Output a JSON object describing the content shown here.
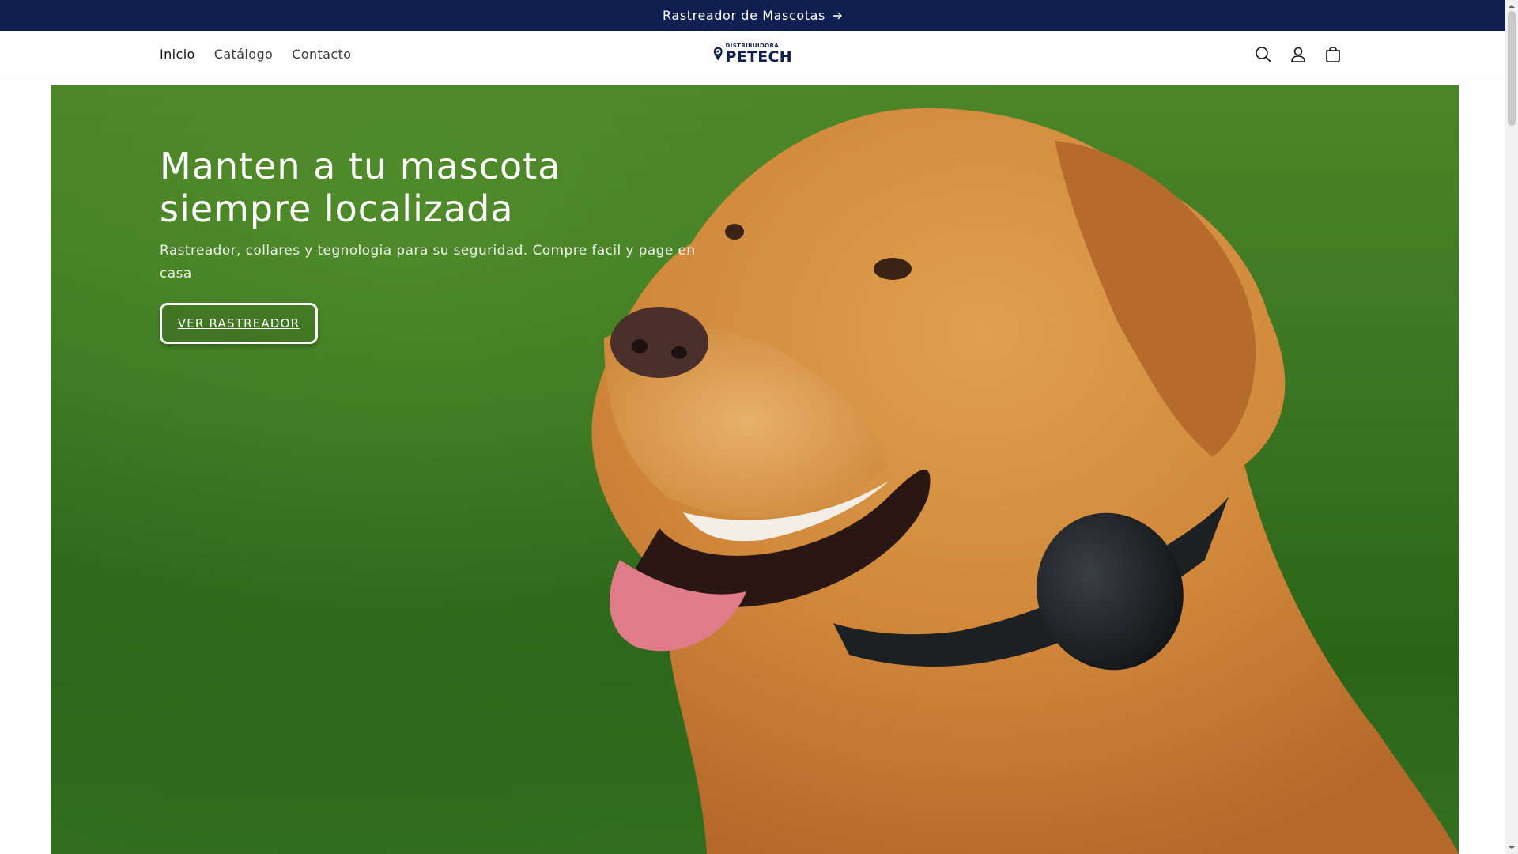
{
  "announcement": {
    "text": "Rastreador de Mascotas",
    "icon": "arrow-right-icon"
  },
  "brand": {
    "logo_small": "DISTRIBUIDORA",
    "logo_name": "PETECH"
  },
  "nav": {
    "items": [
      {
        "label": "Inicio",
        "active": true
      },
      {
        "label": "Catálogo"
      },
      {
        "label": "Contacto"
      }
    ]
  },
  "header_icons": [
    "search-icon",
    "account-icon",
    "cart-icon"
  ],
  "hero": {
    "title": "Manten a tu mascota siempre localizada",
    "subtitle": "Rastreador, collares y tegnologia para su seguridad. Compre facil y page en casa",
    "button_label": "VER RASTREADOR"
  },
  "colors": {
    "announcement_bg": "#0f1f4f",
    "logo": "#0f1f4f",
    "hero_text": "#ffffff"
  }
}
